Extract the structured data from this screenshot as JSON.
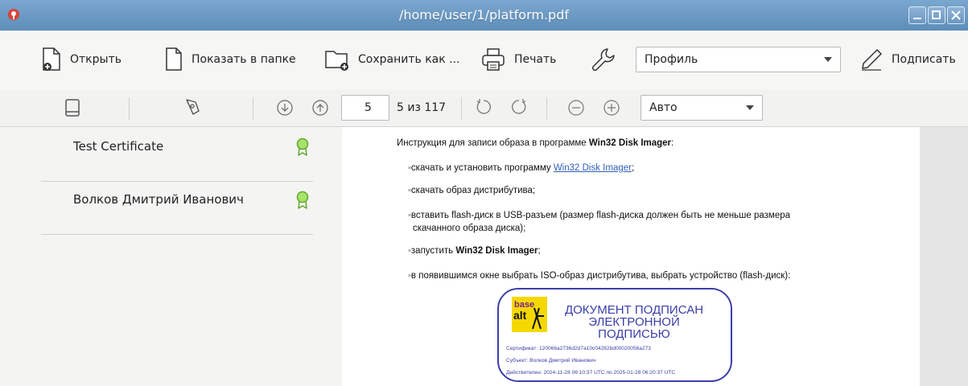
{
  "window": {
    "title": "/home/user/1/platform.pdf"
  },
  "toolbar": {
    "open_label": "Открыть",
    "show_in_folder_label": "Показать в папке",
    "save_as_label": "Сохранить как ...",
    "print_label": "Печать",
    "profile_value": "Профиль",
    "sign_label": "Подписать"
  },
  "navbar": {
    "page_number": "5",
    "page_of": "5 из 117",
    "zoom_value": "Авто"
  },
  "sidebar": {
    "signatures": [
      {
        "name": "Test Certificate"
      },
      {
        "name": "Волков Дмитрий Иванович"
      }
    ]
  },
  "document": {
    "intro_prefix": "Инструкция для записи образа в программе ",
    "intro_bold": "Win32 Disk Imager",
    "intro_suffix": ":",
    "bullet_glyph": "»",
    "item1_prefix": "скачать и установить программу ",
    "item1_link": "Win32 Disk Imager",
    "item1_suffix": ";",
    "item2": "скачать образ дистрибутива;",
    "item3_line1": "вставить flash-диск в USB-разъем (размер flash-диска должен быть не меньше размера",
    "item3_line2": "скачанного образа диска);",
    "item4_prefix": "запустить ",
    "item4_bold": "Win32 Disk Imager",
    "item4_suffix": ";",
    "item5": "в появившимся окне выбрать ISO-образ дистрибутива, выбрать устройство (flash-диск):"
  },
  "stamp": {
    "logo_text_top": "base",
    "logo_text_bottom": "alt",
    "title_line1": "ДОКУМЕНТ ПОДПИСАН",
    "title_line2": "ЭЛЕКТРОННОЙ ПОДПИСЬЮ",
    "certificate": "Сертификат: 120066a2736d2d7a10c04282bd00020056a273",
    "subject": "Субъект: Волков Дмитрий Иванович",
    "valid": "Действителен: 2024-11-28 06:10:37 UTC по 2025-01-28 06:20:37 UTC"
  },
  "colors": {
    "titlebar": "#6a97c1",
    "stamp": "#3b3ea8",
    "badge": "#7fcf3a",
    "link": "#2f5fb8"
  }
}
